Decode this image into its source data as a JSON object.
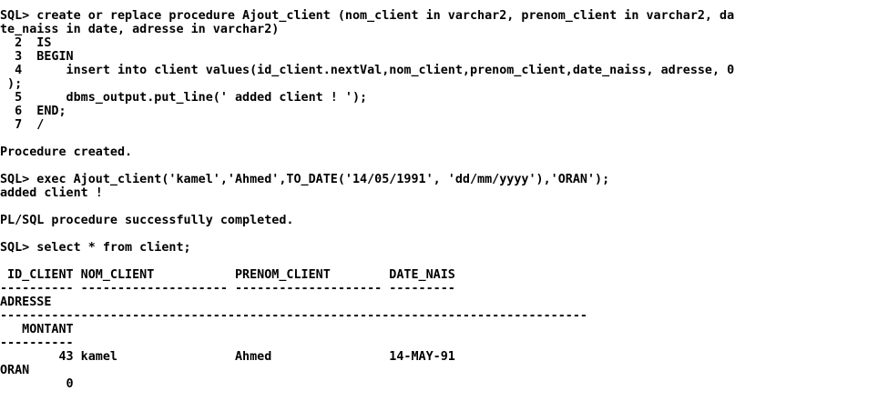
{
  "console": {
    "lines": [
      "SQL> create or replace procedure Ajout_client (nom_client in varchar2, prenom_client in varchar2, da",
      "te_naiss in date, adresse in varchar2)",
      "  2  IS",
      "  3  BEGIN",
      "  4      insert into client values(id_client.nextVal,nom_client,prenom_client,date_naiss, adresse, 0",
      " );",
      "  5      dbms_output.put_line(' added client ! ');",
      "  6  END;",
      "  7  /",
      "",
      "Procedure created.",
      "",
      "SQL> exec Ajout_client('kamel','Ahmed',TO_DATE('14/05/1991', 'dd/mm/yyyy'),'ORAN');",
      "added client !",
      "",
      "PL/SQL procedure successfully completed.",
      "",
      "SQL> select * from client;",
      "",
      " ID_CLIENT NOM_CLIENT           PRENOM_CLIENT        DATE_NAIS",
      "---------- -------------------- -------------------- ---------",
      "ADRESSE",
      "--------------------------------------------------------------------------------",
      "   MONTANT",
      "----------",
      "        43 kamel                Ahmed                14-MAY-91",
      "ORAN",
      "         0"
    ]
  }
}
